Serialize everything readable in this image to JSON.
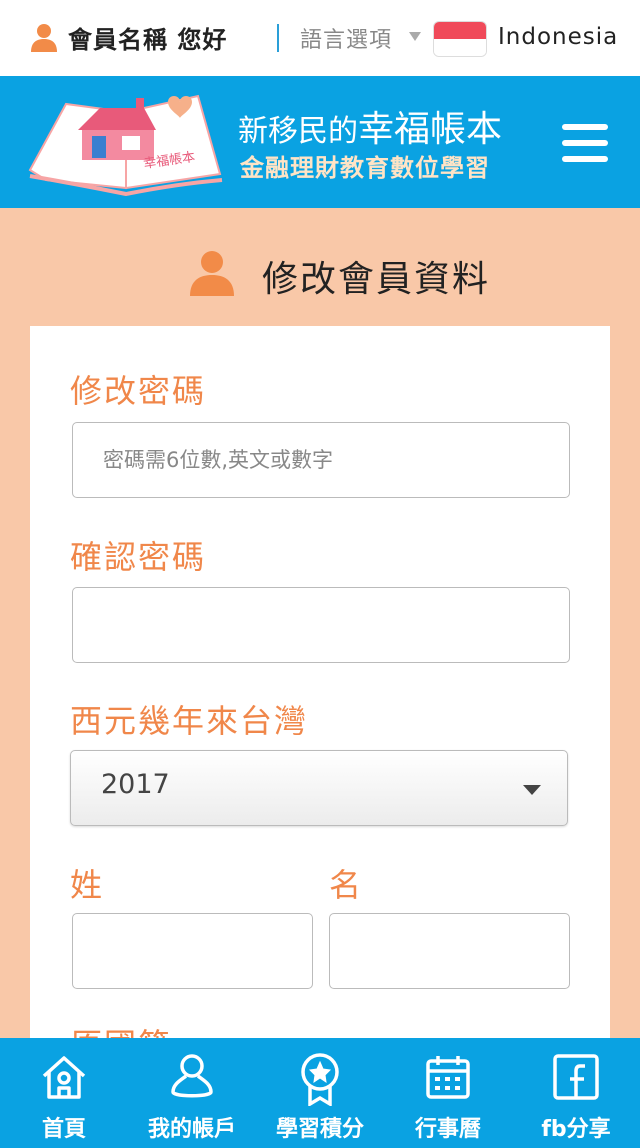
{
  "topbar": {
    "username": "會員名稱 您好",
    "language_label": "語言選項",
    "country": "Indonesia"
  },
  "header": {
    "logo_book_text": "幸福帳本",
    "title_small": "新移民的",
    "title_big": "幸福帳本",
    "subtitle": "金融理財教育數位學習"
  },
  "page": {
    "title": "修改會員資料"
  },
  "form": {
    "password_label": "修改密碼",
    "password_placeholder": "密碼需6位數,英文或數字",
    "confirm_label": "確認密碼",
    "year_label": "西元幾年來台灣",
    "year_value": "2017",
    "surname_label": "姓",
    "given_label": "名",
    "nationality_label": "原國籍"
  },
  "nav": {
    "items": [
      {
        "label": "首頁",
        "icon": "home-icon"
      },
      {
        "label": "我的帳戶",
        "icon": "account-icon"
      },
      {
        "label": "學習積分",
        "icon": "badge-icon"
      },
      {
        "label": "行事曆",
        "icon": "calendar-icon"
      },
      {
        "label": "fb分享",
        "icon": "facebook-icon"
      }
    ]
  },
  "colors": {
    "accent_blue": "#0aa2e2",
    "accent_orange": "#f0874a",
    "background_peach": "#f9c8a8"
  }
}
